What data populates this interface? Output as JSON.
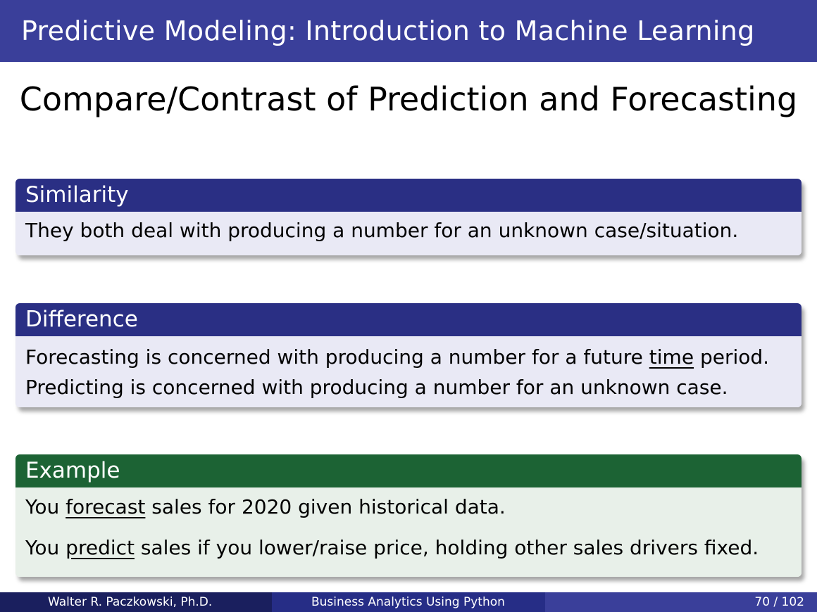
{
  "header": {
    "title": "Predictive Modeling: Introduction to Machine Learning"
  },
  "slide": {
    "title": "Compare/Contrast of Prediction and Forecasting"
  },
  "blocks": {
    "similarity": {
      "heading": "Similarity",
      "text": "They both deal with producing a number for an unknown case/situation."
    },
    "difference": {
      "heading": "Difference",
      "line1_pre": "Forecasting is concerned with producing a number for a future ",
      "line1_underlined": "time",
      "line1_post": " period.",
      "line2": "Predicting is concerned with producing a number for an unknown case."
    },
    "example": {
      "heading": "Example",
      "line1_pre": "You ",
      "line1_underlined": "forecast",
      "line1_post": " sales for 2020 given historical data.",
      "line2_pre": "You ",
      "line2_underlined": "predict",
      "line2_post": " sales if you lower/raise price, holding other sales drivers fixed."
    }
  },
  "footer": {
    "author": "Walter R. Paczkowski, Ph.D.",
    "course": "Business Analytics Using Python",
    "page": "70 / 102"
  },
  "colors": {
    "header_bg": "#3a3f9a",
    "block_blue_head": "#2a2f84",
    "block_blue_body": "#e9e9f5",
    "block_green_head": "#1c6334",
    "block_green_body": "#e8f0e9"
  }
}
